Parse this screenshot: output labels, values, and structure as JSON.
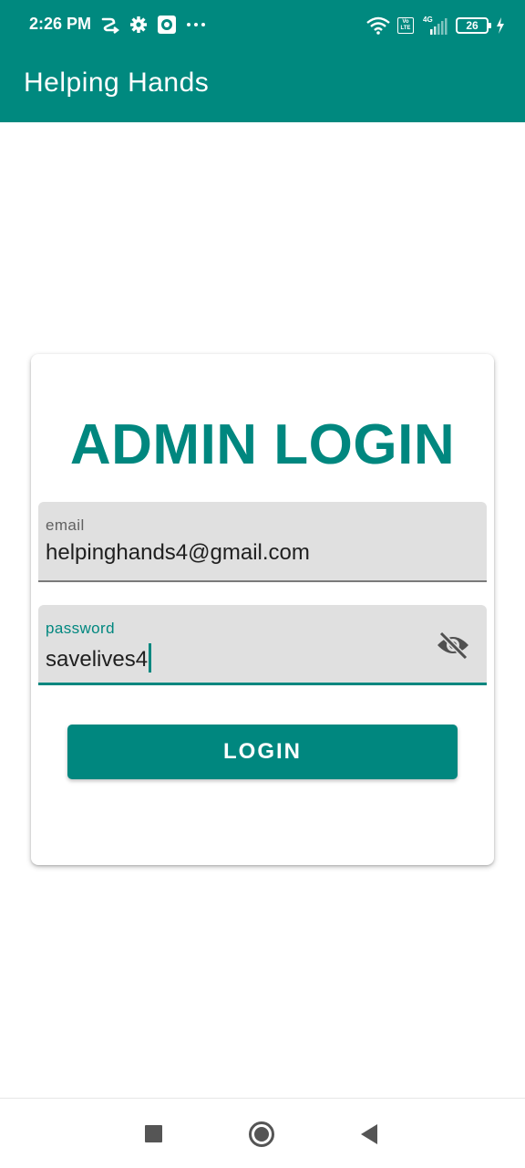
{
  "status_bar": {
    "time": "2:26 PM",
    "left_icons": [
      "route-icon",
      "gear-icon",
      "record-icon",
      "more-dots-icon"
    ],
    "right_icons": [
      "wifi-icon",
      "volte-icon",
      "signal-icon",
      "battery-icon",
      "charging-icon"
    ],
    "network": "4G",
    "volte_text": "Vo LTE",
    "battery_level": "26",
    "color": "#00897f"
  },
  "app_bar": {
    "title": "Helping Hands",
    "color": "#00897f"
  },
  "login_card": {
    "title": "ADMIN LOGIN",
    "title_color": "#00877f",
    "email_field": {
      "label": "email",
      "value": "helpinghands4@gmail.com"
    },
    "password_field": {
      "label": "password",
      "value": "savelives4",
      "toggle_icon": "visibility-off-icon",
      "focused": true
    },
    "login_button_label": "LOGIN",
    "accent_color": "#00877f"
  },
  "nav_bar": {
    "icons": [
      "recents-icon",
      "home-icon",
      "back-icon"
    ]
  }
}
